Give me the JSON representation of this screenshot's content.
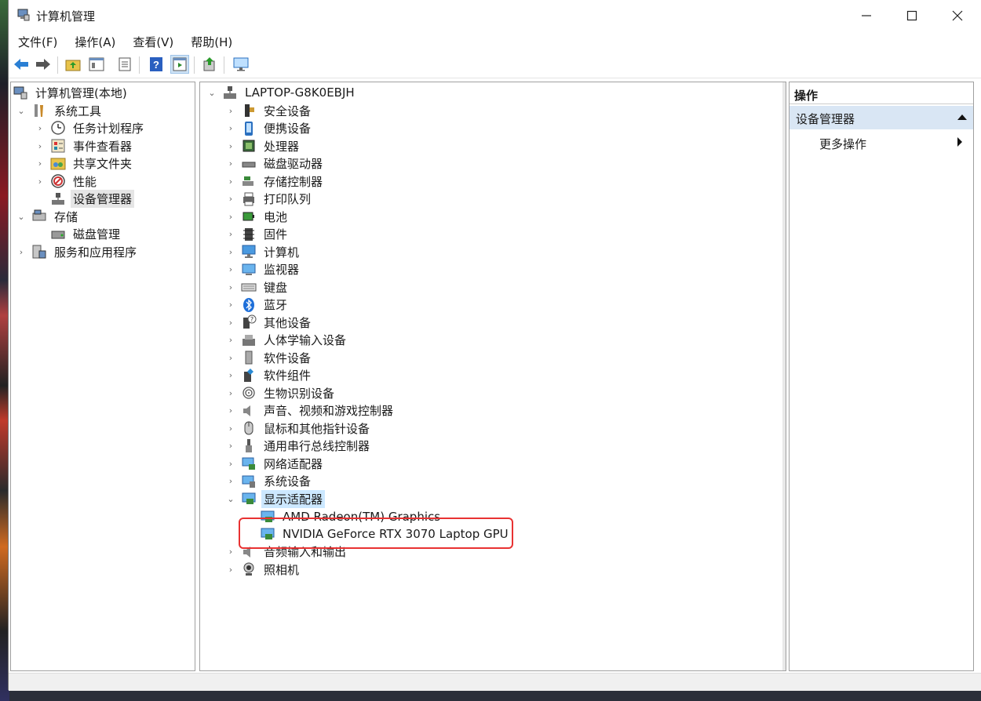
{
  "window": {
    "title": "计算机管理"
  },
  "menu": [
    "文件(F)",
    "操作(A)",
    "查看(V)",
    "帮助(H)"
  ],
  "toolbar": [
    "back-icon",
    "forward-icon",
    "up-folder-icon",
    "show-tree-icon",
    "properties-icon",
    "help-icon",
    "console-icon",
    "export-icon",
    "monitor-icon"
  ],
  "tree": {
    "root": "计算机管理(本地)",
    "system_tools": "系统工具",
    "task_scheduler": "任务计划程序",
    "event_viewer": "事件查看器",
    "shared_folders": "共享文件夹",
    "performance": "性能",
    "device_manager": "设备管理器",
    "storage": "存储",
    "disk_management": "磁盘管理",
    "services": "服务和应用程序"
  },
  "devices": {
    "computer_name": "LAPTOP-G8K0EBJH",
    "categories": [
      {
        "label": "安全设备",
        "icon": "security-device-icon"
      },
      {
        "label": "便携设备",
        "icon": "portable-device-icon"
      },
      {
        "label": "处理器",
        "icon": "processor-icon"
      },
      {
        "label": "磁盘驱动器",
        "icon": "disk-drive-icon"
      },
      {
        "label": "存储控制器",
        "icon": "storage-controller-icon"
      },
      {
        "label": "打印队列",
        "icon": "printer-icon"
      },
      {
        "label": "电池",
        "icon": "battery-icon"
      },
      {
        "label": "固件",
        "icon": "firmware-icon"
      },
      {
        "label": "计算机",
        "icon": "computer-icon"
      },
      {
        "label": "监视器",
        "icon": "monitor-icon"
      },
      {
        "label": "键盘",
        "icon": "keyboard-icon"
      },
      {
        "label": "蓝牙",
        "icon": "bluetooth-icon"
      },
      {
        "label": "其他设备",
        "icon": "other-device-icon"
      },
      {
        "label": "人体学输入设备",
        "icon": "hid-icon"
      },
      {
        "label": "软件设备",
        "icon": "software-device-icon"
      },
      {
        "label": "软件组件",
        "icon": "software-component-icon"
      },
      {
        "label": "生物识别设备",
        "icon": "biometric-icon"
      },
      {
        "label": "声音、视频和游戏控制器",
        "icon": "sound-icon"
      },
      {
        "label": "鼠标和其他指针设备",
        "icon": "mouse-icon"
      },
      {
        "label": "通用串行总线控制器",
        "icon": "usb-icon"
      },
      {
        "label": "网络适配器",
        "icon": "network-adapter-icon"
      },
      {
        "label": "系统设备",
        "icon": "system-device-icon"
      },
      {
        "label": "显示适配器",
        "icon": "display-adapter-icon"
      }
    ],
    "display_adapters": [
      "AMD Radeon(TM) Graphics",
      "NVIDIA GeForce RTX 3070 Laptop GPU"
    ],
    "after": [
      {
        "label": "音频输入和输出",
        "icon": "audio-io-icon"
      },
      {
        "label": "照相机",
        "icon": "camera-icon"
      }
    ]
  },
  "actions": {
    "header": "操作",
    "section": "设备管理器",
    "more": "更多操作"
  },
  "colors": {
    "highlight": "#cce8ff",
    "annotation": "#e83232",
    "action_section": "#d9e6f4"
  }
}
